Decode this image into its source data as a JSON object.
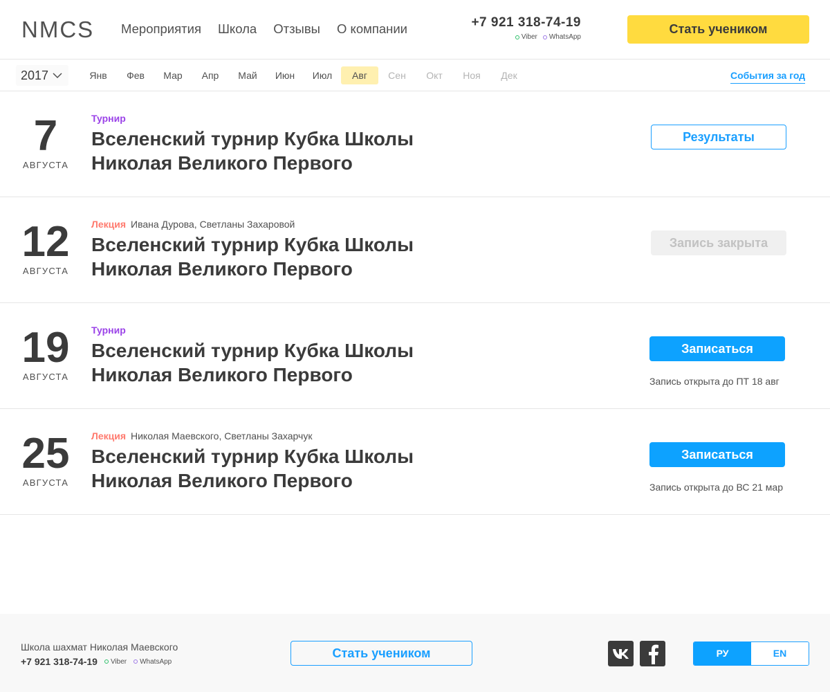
{
  "header": {
    "logo": "NMCS",
    "nav": [
      "Мероприятия",
      "Школа",
      "Отзывы",
      "О компании"
    ],
    "phone": "+7 921 318-74-19",
    "viber": "Viber",
    "whatsapp": "WhatsApp",
    "cta": "Стать учеником"
  },
  "calendar": {
    "year": "2017",
    "months": [
      "Янв",
      "Фев",
      "Мар",
      "Апр",
      "Май",
      "Июн",
      "Июл",
      "Авг",
      "Сен",
      "Окт",
      "Ноя",
      "Дек"
    ],
    "active_month": "Авг",
    "year_events_link": "События за год"
  },
  "events": [
    {
      "day": "7",
      "month": "августа",
      "type": "Турнир",
      "authors": "",
      "title": "Вселенский турнир Кубка Школы Николая Великого Первого",
      "button": "Результаты",
      "deadline": ""
    },
    {
      "day": "12",
      "month": "августа",
      "type": "Лекция",
      "authors": "Ивана Дурова, Светланы Захаровой",
      "title": "Вселенский турнир Кубка Школы Николая Великого Первого",
      "button": "Запись закрыта",
      "deadline": ""
    },
    {
      "day": "19",
      "month": "августа",
      "type": "Турнир",
      "authors": "",
      "title": "Вселенский турнир Кубка Школы Николая Великого Первого",
      "button": "Записаться",
      "deadline": "Запись открыта до ПТ 18 авг"
    },
    {
      "day": "25",
      "month": "августа",
      "type": "Лекция",
      "authors": "Николая Маевского, Светланы Захарчук",
      "title": "Вселенский турнир Кубка Школы Николая Великого Первого",
      "button": "Записаться",
      "deadline": "Запись открыта до ВС 21 мар"
    }
  ],
  "footer": {
    "school": "Школа шахмат Николая Маевского",
    "phone": "+7 921 318-74-19",
    "viber": "Viber",
    "whatsapp": "WhatsApp",
    "cta": "Стать учеником",
    "lang_ru": "РУ",
    "lang_en": "EN"
  },
  "colors": {
    "accent_yellow": "#ffdb3f",
    "accent_blue": "#0da2ff",
    "tournament": "#9b43e8",
    "lecture": "#ff7a6e"
  },
  "icons": [
    "chevron-down-icon",
    "vk-icon",
    "facebook-icon"
  ]
}
